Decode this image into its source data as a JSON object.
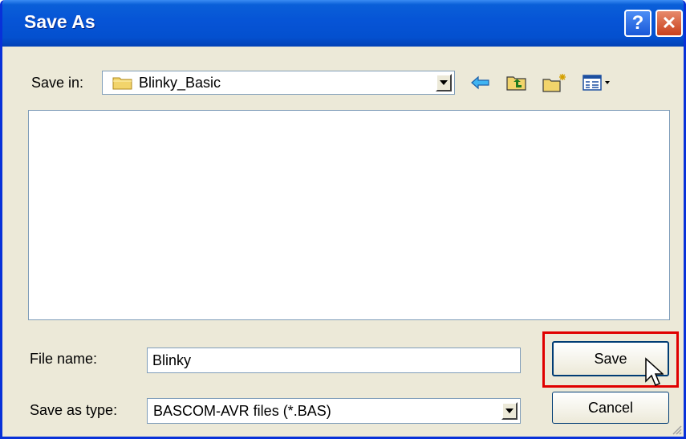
{
  "window": {
    "title": "Save As",
    "help_label": "?",
    "close_label": "✕"
  },
  "location": {
    "label": "Save in:",
    "value": "Blinky_Basic"
  },
  "toolbar": {
    "icons": [
      "back-arrow-icon",
      "up-one-level-icon",
      "new-folder-icon",
      "view-menu-icon"
    ]
  },
  "file_name": {
    "label": "File name:",
    "value": "Blinky"
  },
  "save_type": {
    "label": "Save as type:",
    "value": "BASCOM-AVR files (*.BAS)"
  },
  "buttons": {
    "save": "Save",
    "cancel": "Cancel"
  },
  "colors": {
    "titlebar": "#0654d6",
    "highlight": "#e00000",
    "dialog_bg": "#ece9d8"
  }
}
